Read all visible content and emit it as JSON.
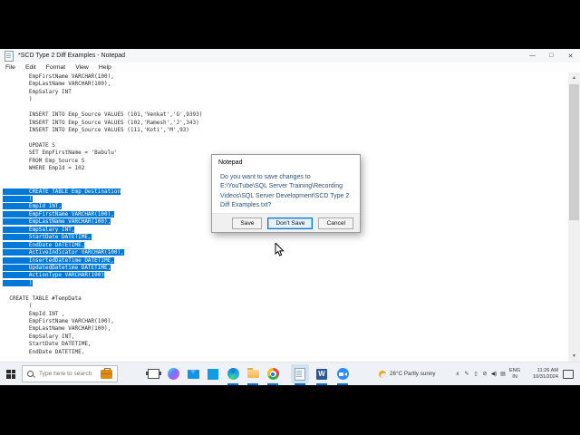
{
  "window": {
    "title": "*SCD Type 2 Diff Examples - Notepad",
    "menu": [
      "File",
      "Edit",
      "Format",
      "View",
      "Help"
    ],
    "controls": {
      "minimize": "—",
      "maximize": "□",
      "close": "✕"
    }
  },
  "editor": {
    "selection_color": "#0078d7",
    "lines": [
      {
        "t": "\tEmpFirstName VARCHAR(100),",
        "s": false
      },
      {
        "t": "\tEmpLastName VARCHAR(100),",
        "s": false
      },
      {
        "t": "\tEmpSalary INT",
        "s": false
      },
      {
        "t": "\t)",
        "s": false
      },
      {
        "t": "",
        "s": false
      },
      {
        "t": "\tINSERT INTO Emp_Source VALUES (101,'Venkat','G',9393)",
        "s": false
      },
      {
        "t": "\tINSERT INTO Emp_Source VALUES (102,'Ramesh','J',343)",
        "s": false
      },
      {
        "t": "\tINSERT INTO Emp_Source VALUES (111,'Koti','M',93)",
        "s": false
      },
      {
        "t": "",
        "s": false
      },
      {
        "t": "\tUPDATE S",
        "s": false
      },
      {
        "t": "\tSET EmpFirstName = 'Babulu'",
        "s": false
      },
      {
        "t": "\tFROM Emp_Source S",
        "s": false
      },
      {
        "t": "\tWHERE EmpId = 102",
        "s": false
      },
      {
        "t": "",
        "s": false
      },
      {
        "t": "",
        "s": false
      },
      {
        "t": "\tCREATE TABLE Emp_Destination",
        "s": true
      },
      {
        "t": "\t(",
        "s": true
      },
      {
        "t": "\tEmpId INT,",
        "s": true
      },
      {
        "t": "\tEmpFirstName VARCHAR(100),",
        "s": true
      },
      {
        "t": "\tEmpLastName VARCHAR(100),",
        "s": true
      },
      {
        "t": "\tEmpSalary INT,",
        "s": true
      },
      {
        "t": "\tStartDate DATETIME,",
        "s": true
      },
      {
        "t": "\tEndDate DATETIME,",
        "s": true
      },
      {
        "t": "\tActiveIndicator VARCHAR(100),",
        "s": true
      },
      {
        "t": "\tInsertedDateTime DATETIME,",
        "s": true
      },
      {
        "t": "\tUpdatedDatetime DATETIME,",
        "s": true
      },
      {
        "t": "\tActionType VARCHAR(100)",
        "s": true
      },
      {
        "t": "\t)",
        "s": true
      },
      {
        "t": "",
        "s": false
      },
      {
        "t": "  CREATE TABLE #TempData",
        "s": false
      },
      {
        "t": "\t(",
        "s": false
      },
      {
        "t": "\tEmpId INT ,",
        "s": false
      },
      {
        "t": "\tEmpFirstName VARCHAR(100),",
        "s": false
      },
      {
        "t": "\tEmpLastName VARCHAR(100),",
        "s": false
      },
      {
        "t": "\tEmpSalary INT,",
        "s": false
      },
      {
        "t": "\tStartDate DATETIME,",
        "s": false
      },
      {
        "t": "\tEndDate DATETIME.",
        "s": false
      }
    ]
  },
  "dialog": {
    "title": "Notepad",
    "message_lines": [
      "Do you want to save changes to",
      "E:\\YouTube\\SQL Server Training\\Recording",
      "Videos\\SQL Server Development\\SCD Type 2",
      "Diff Examples.txt?"
    ],
    "buttons": [
      {
        "label": "Save",
        "default": false
      },
      {
        "label": "Don't Save",
        "default": true
      },
      {
        "label": "Cancel",
        "default": false
      }
    ]
  },
  "taskbar": {
    "search_placeholder": "Type here to search",
    "app_icons": [
      "start-icon",
      "search-icon",
      "briefcase-icon",
      "task-view-icon",
      "copilot-icon",
      "mail-icon",
      "vscode-icon",
      "edge-icon",
      "file-explorer-icon",
      "chrome-icon",
      "notepad-icon",
      "word-icon",
      "zoom-icon"
    ],
    "active_app": "notepad",
    "running_apps": [
      "edge",
      "file-explorer",
      "chrome",
      "notepad",
      "word",
      "zoom"
    ],
    "weather": {
      "temperature": "26°C",
      "condition": "Partly sunny"
    },
    "tray_glyphs": [
      {
        "name": "chevron-up-icon",
        "glyph": "∧"
      },
      {
        "name": "pen-icon",
        "glyph": "✎"
      },
      {
        "name": "battery-icon",
        "glyph": "▯"
      },
      {
        "name": "bluetooth-off-icon",
        "glyph": "⊘"
      },
      {
        "name": "volume-icon",
        "glyph": "◀)"
      },
      {
        "name": "touch-indicator-icon",
        "glyph": "▤"
      }
    ],
    "language_top": "ENG",
    "language_bottom": "IN",
    "time": "11:26 AM",
    "date": "10/31/2024"
  },
  "colors": {
    "selection": "#0078d7",
    "accent": "#0078d7",
    "taskbar_bg": "#eef1f5",
    "dialog_text": "#2f527b"
  }
}
